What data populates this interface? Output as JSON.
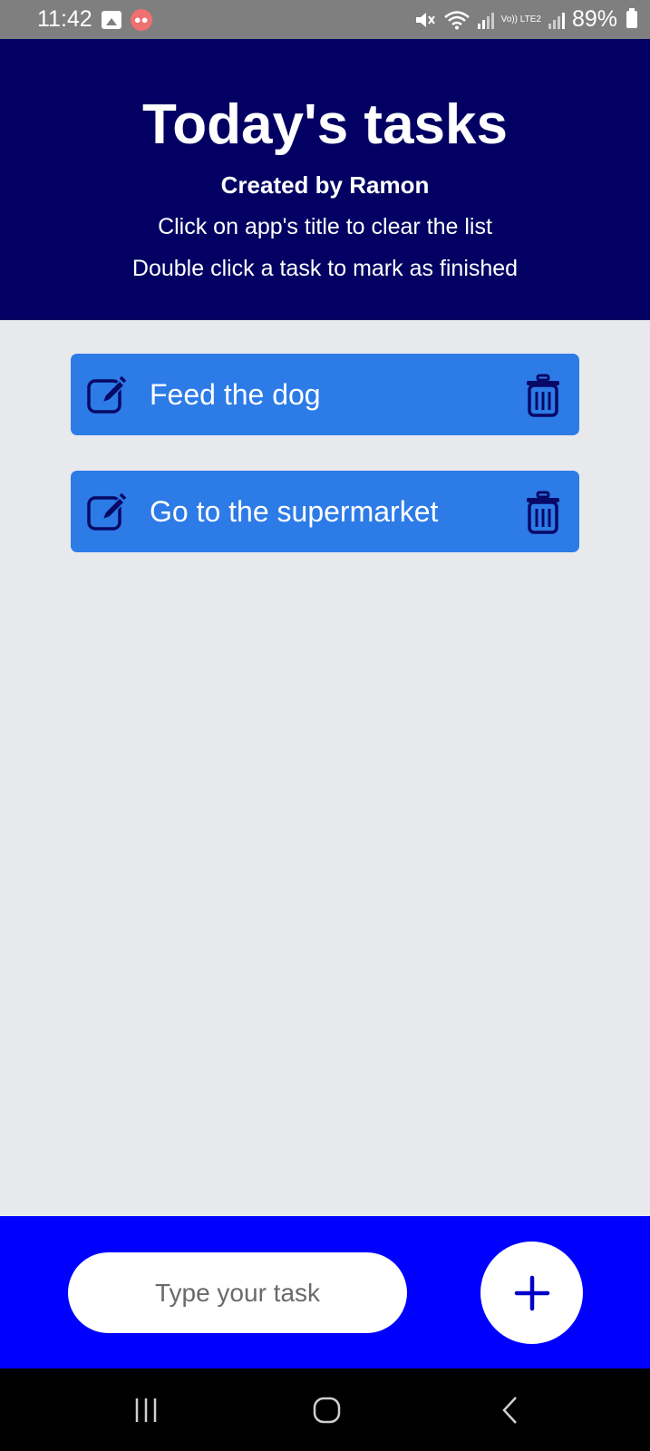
{
  "status_bar": {
    "time": "11:42",
    "battery": "89%",
    "network_label": "Vo)) LTE2",
    "icons": [
      "gallery-icon",
      "people-icon",
      "mute-icon",
      "wifi-icon",
      "signal-icon",
      "signal-icon",
      "battery-icon"
    ]
  },
  "header": {
    "title": "Today's tasks",
    "author": "Created by Ramon",
    "hint_clear": "Click on app's title to clear the list",
    "hint_finish": "Double click a task to mark as finished"
  },
  "tasks": [
    {
      "text": "Feed the dog"
    },
    {
      "text": "Go to the supermarket"
    }
  ],
  "input": {
    "placeholder": "Type your task",
    "value": "",
    "add_icon": "plus-icon"
  },
  "colors": {
    "header_bg": "#020062",
    "task_bg": "#2c7be7",
    "task_icon": "#080866",
    "input_bar_bg": "#0000fe",
    "add_icon": "#0000c8",
    "page_bg": "#e8e9ed"
  },
  "nav": {
    "icons": [
      "recent-apps-icon",
      "home-icon",
      "back-icon"
    ]
  }
}
